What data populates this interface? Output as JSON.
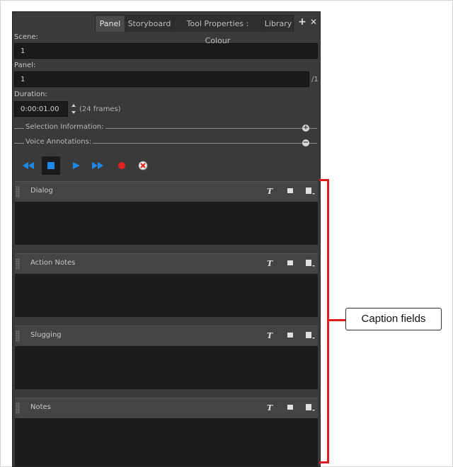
{
  "tabs": [
    {
      "label": "Panel",
      "active": true
    },
    {
      "label": "Storyboard",
      "active": false
    },
    {
      "label": "Tool Properties : Colour",
      "active": false
    },
    {
      "label": "Library",
      "active": false
    }
  ],
  "tab_buttons": {
    "add": "+",
    "close": "✕"
  },
  "scene": {
    "label": "Scene:",
    "value": "1"
  },
  "panel_field": {
    "label": "Panel:",
    "value": "1",
    "suffix": "/1"
  },
  "duration": {
    "label": "Duration:",
    "value": "0:00:01.00",
    "frames": "(24 frames)"
  },
  "sections": {
    "selection": {
      "label": "Selection Information:",
      "icon": "plus-circle-icon"
    },
    "voice": {
      "label": "Voice Annotations:",
      "icon": "minus-circle-icon"
    }
  },
  "transport": [
    {
      "name": "rewind-button",
      "icon": "rewind-icon"
    },
    {
      "name": "stop-button",
      "icon": "stop-icon"
    },
    {
      "name": "play-button",
      "icon": "play-icon"
    },
    {
      "name": "fast-forward-button",
      "icon": "fast-forward-icon"
    },
    {
      "name": "record-button",
      "icon": "record-icon"
    },
    {
      "name": "delete-sound-button",
      "icon": "delete-sound-icon"
    }
  ],
  "captions": [
    {
      "title": "Dialog"
    },
    {
      "title": "Action Notes"
    },
    {
      "title": "Slugging"
    },
    {
      "title": "Notes"
    }
  ],
  "caption_icons": {
    "text": "T",
    "format": "text-format-icon",
    "menu": "caption-menu-icon"
  },
  "callout": {
    "label": "Caption fields",
    "color": "#e21d1d"
  },
  "colors": {
    "panel_bg": "#3a3a3a",
    "field_bg": "#1b1b1b",
    "accent_blue": "#1e88e5",
    "record_red": "#e02020"
  }
}
